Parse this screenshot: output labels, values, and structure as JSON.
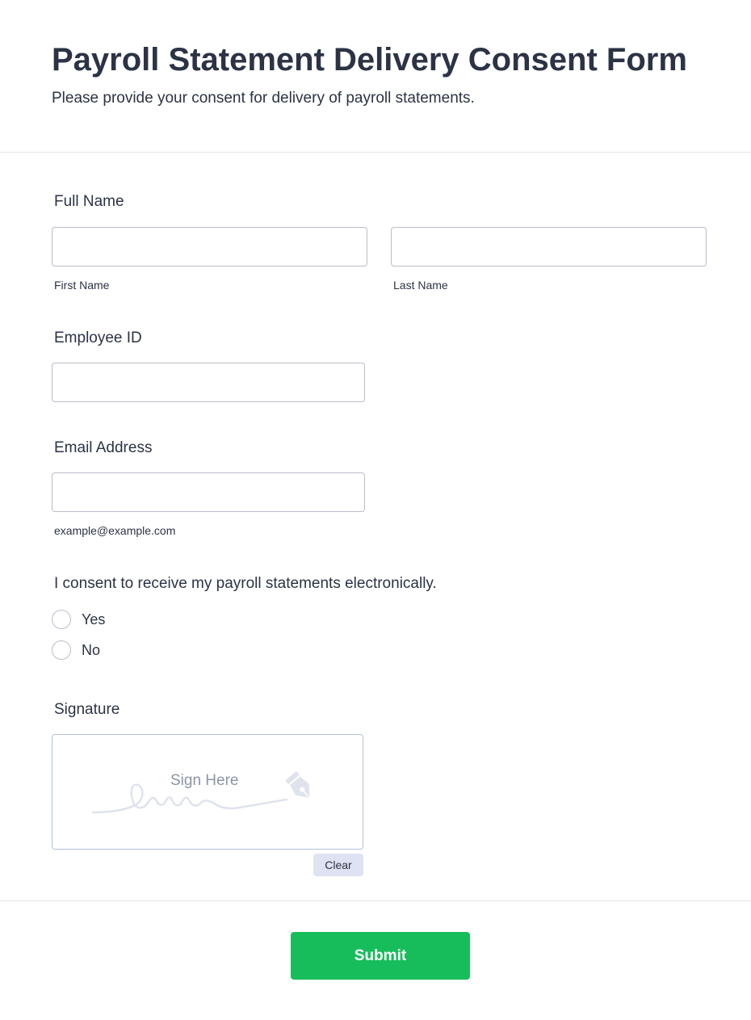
{
  "header": {
    "title": "Payroll Statement Delivery Consent Form",
    "subtitle": "Please provide your consent for delivery of payroll statements."
  },
  "full_name": {
    "label": "Full Name",
    "first": {
      "value": "",
      "sublabel": "First Name"
    },
    "last": {
      "value": "",
      "sublabel": "Last Name"
    }
  },
  "employee_id": {
    "label": "Employee ID",
    "value": ""
  },
  "email": {
    "label": "Email Address",
    "value": "",
    "sublabel": "example@example.com"
  },
  "consent": {
    "question": "I consent to receive my payroll statements electronically.",
    "options": [
      "Yes",
      "No"
    ],
    "selected": null
  },
  "signature": {
    "label": "Signature",
    "placeholder": "Sign Here",
    "icon": "pen-nib-icon",
    "clear_label": "Clear"
  },
  "submit": {
    "label": "Submit"
  },
  "colors": {
    "text": "#2c3345",
    "border": "#b8bdc9",
    "submit_bg": "#18bd5b",
    "clear_bg": "#dfe2f2"
  }
}
